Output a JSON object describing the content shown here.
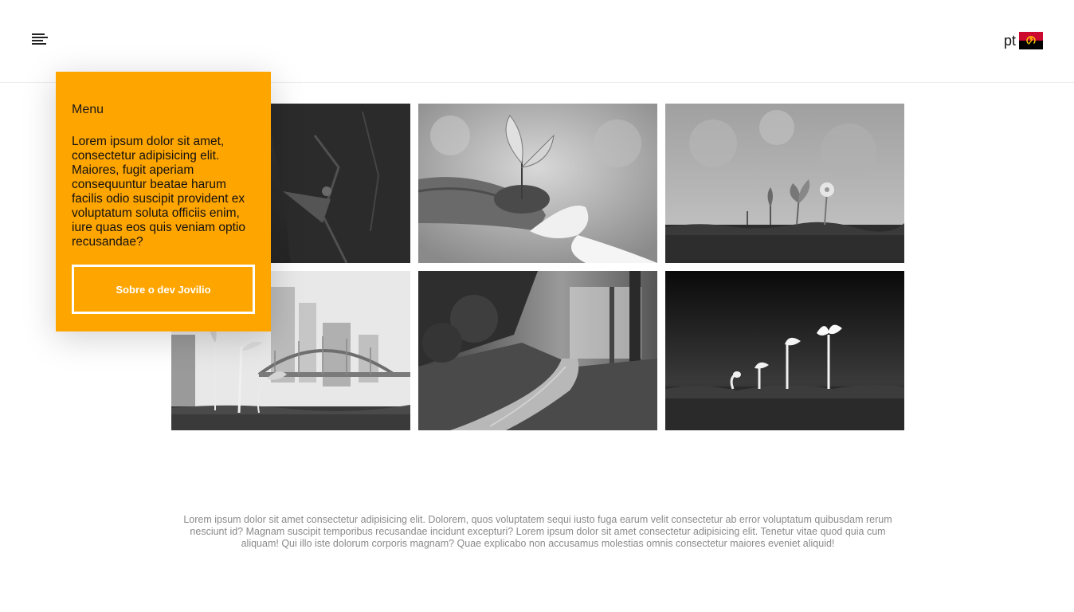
{
  "header": {
    "menu_icon": "hamburger-menu-icon",
    "language_code": "pt",
    "flag_icon": "angola-flag-icon",
    "flag_colors": {
      "top": "#cc092f",
      "bottom": "#000000",
      "emblem": "#ffcb00"
    }
  },
  "menu_panel": {
    "title": "Menu",
    "text": "Lorem ipsum dolor sit amet, consectetur adipisicing elit. Maiores, fugit aperiam consequuntur beatae harum facilis odio suscipit provident ex voluptatum soluta officiis enim, iure quas eos quis veniam optio recusandae?",
    "button_label": "Sobre o dev Jovilio",
    "background_color": "#ffa500"
  },
  "gallery": {
    "images": [
      {
        "name": "mountain-cliff"
      },
      {
        "name": "hands-holding-seedling"
      },
      {
        "name": "sprouts-and-flower"
      },
      {
        "name": "seedlings-city-bridge"
      },
      {
        "name": "forest-path"
      },
      {
        "name": "seed-germination-stages"
      }
    ]
  },
  "footer": {
    "text": "Lorem ipsum dolor sit amet consectetur adipisicing elit. Dolorem, quos voluptatem sequi iusto fuga earum velit consectetur ab error voluptatum quibusdam rerum nesciunt id? Magnam suscipit temporibus recusandae incidunt excepturi? Lorem ipsum dolor sit amet consectetur adipisicing elit. Tenetur vitae quod quia cum aliquam! Qui illo iste dolorum corporis magnam? Quae explicabo non accusamus molestias omnis consectetur maiores eveniet aliquid!"
  }
}
